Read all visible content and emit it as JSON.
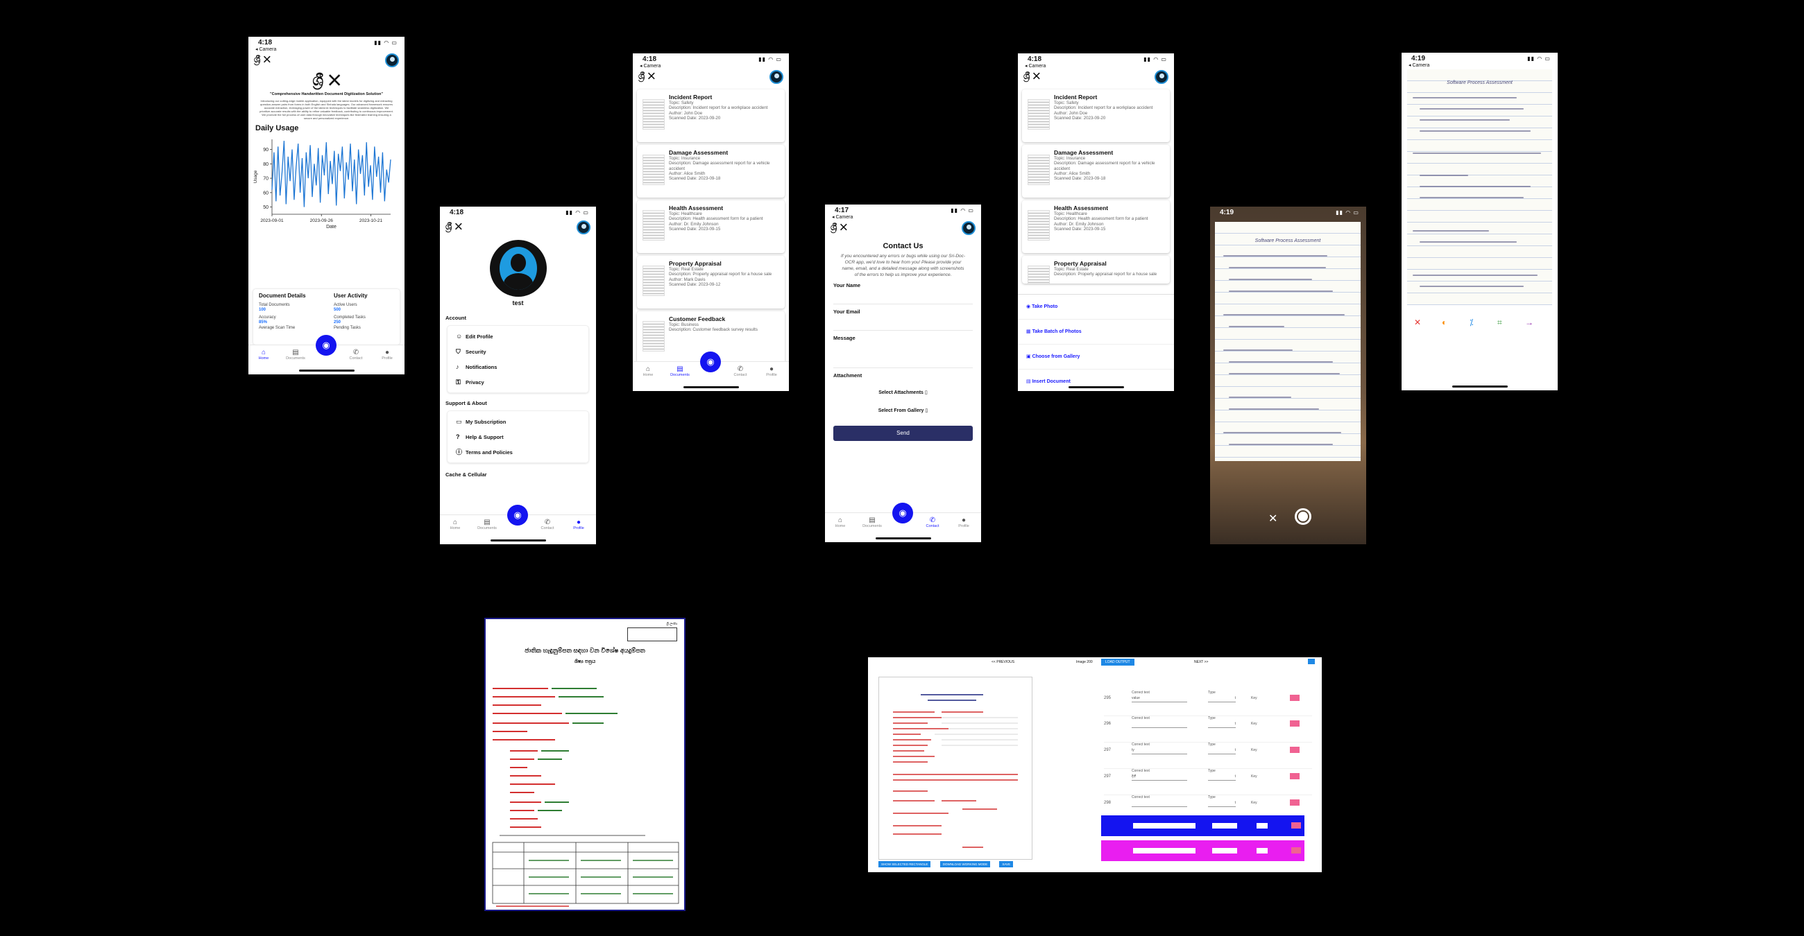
{
  "status": {
    "time_a": "4:18",
    "time_b": "4:17",
    "time_c": "4:19",
    "back": "◂ Camera",
    "icons": "▮▮ ◠ ▭"
  },
  "brand": {
    "logo": "ශ්‍රී ✕",
    "tagline": "\"Comprehensive Handwritten Document Digitization Solution\"",
    "intro": "Introducing our cutting-edge mobile application, equipped with the latest models for digitizing and extracting question-answer pairs from forms in both English and Sinhala languages. Our advanced framework ensures accurate extraction, leveraging power of the latest AI techniques to facilitate seamless digitization. We prioritize accurate results with the ability to refine valuable feedback, contributing to continuous improvement. We promote the full process of user data through innovative techniques like federated learning ensuring a secure and personalized experience."
  },
  "home": {
    "daily_title": "Daily Usage",
    "ylabel": "Usage",
    "xlabel": "Date",
    "details_title": "Document Details",
    "total_label": "Total Documents",
    "total_value": "100",
    "accuracy_label": "Accuracy",
    "accuracy_value": "85%",
    "avg_label": "Average Scan Time",
    "activity_title": "User Activity",
    "active_label": "Active Users",
    "active_value": "500",
    "completed_label": "Completed Tasks",
    "completed_value": "250",
    "pending_label": "Pending Tasks"
  },
  "chart_data": {
    "type": "line",
    "title": "Daily Usage",
    "xlabel": "Date",
    "ylabel": "Usage",
    "ylim": [
      45,
      97
    ],
    "yticks": [
      50,
      60,
      70,
      80,
      90
    ],
    "xticks": [
      "2023-09-01",
      "2023-09-26",
      "2023-10-21"
    ],
    "x_range": [
      "2023-09-01",
      "2023-10-31"
    ],
    "values": [
      62,
      88,
      54,
      92,
      58,
      74,
      96,
      52,
      85,
      68,
      90,
      55,
      78,
      94,
      60,
      84,
      50,
      88,
      70,
      93,
      57,
      80,
      65,
      91,
      53,
      86,
      72,
      95,
      59,
      82,
      66,
      89,
      51,
      87,
      75,
      92,
      56,
      81,
      69,
      94,
      61,
      83,
      52,
      90,
      73,
      86,
      58,
      95,
      64,
      79,
      55,
      92,
      71,
      85,
      60,
      88,
      54,
      76,
      67,
      83
    ],
    "grid": false
  },
  "tabs": [
    "Home",
    "Documents",
    "Contact",
    "Profile"
  ],
  "profile": {
    "name": "test",
    "account_title": "Account",
    "account_items": [
      "Edit Profile",
      "Security",
      "Notifications",
      "Privacy"
    ],
    "support_title": "Support & About",
    "support_items": [
      "My Subscription",
      "Help & Support",
      "Terms and Policies"
    ],
    "cache_title": "Cache & Cellular"
  },
  "documents": [
    {
      "title": "Incident Report",
      "topic": "Topic: Safety",
      "desc": "Description: Incident report for a workplace accident",
      "author": "Author: John Doe",
      "date": "Scanned Date: 2023-09-20"
    },
    {
      "title": "Damage Assessment",
      "topic": "Topic: Insurance",
      "desc": "Description: Damage assessment report for a vehicle accident",
      "author": "Author: Alice Smith",
      "date": "Scanned Date: 2023-09-18"
    },
    {
      "title": "Health Assessment",
      "topic": "Topic: Healthcare",
      "desc": "Description: Health assessment form for a patient",
      "author": "Author: Dr. Emily Johnson",
      "date": "Scanned Date: 2023-09-15"
    },
    {
      "title": "Property Appraisal",
      "topic": "Topic: Real Estate",
      "desc": "Description: Property appraisal report for a house sale",
      "author": "Author: Mark Davis",
      "date": "Scanned Date: 2023-09-12"
    },
    {
      "title": "Customer Feedback",
      "topic": "Topic: Business",
      "desc": "Description: Customer feedback survey results",
      "author": "",
      "date": ""
    }
  ],
  "contact": {
    "title": "Contact Us",
    "intro": "If you encountered any errors or bugs while using our Sri-Doc-OCR app, we'd love to hear from you! Please provide your name, email, and a detailed message along with screenshots of the errors to help us improve your experience.",
    "name_label": "Your Name",
    "email_label": "Your Email",
    "message_label": "Message",
    "attachment_label": "Attachment",
    "select_attachments": "Select Attachments",
    "select_gallery": "Select From Gallery",
    "send": "Send"
  },
  "sheet": {
    "options": [
      "Take Photo",
      "Take Batch of Photos",
      "Choose from Gallery",
      "Insert Document"
    ]
  },
  "scan_doc_title": "Software Process Assessment",
  "form": {
    "tag": "ශ්‍රී ලංකා",
    "heading": "ජාතික හැඳුනුම්පත සඳහා වන විශේෂ අයදුම්පත",
    "sub": "ශිෂ්‍ය පත්‍රය"
  },
  "editor": {
    "top": [
      "<< PREVIOUS",
      "Image 200",
      "LOAD OUTPUT",
      "NEXT >>"
    ],
    "rows": [
      {
        "num": "295",
        "value": "value"
      },
      {
        "num": "296",
        "value": ""
      },
      {
        "num": "297",
        "value": "ty"
      },
      {
        "num": "297",
        "value": "දිනී"
      },
      {
        "num": "298",
        "value": ""
      }
    ],
    "correct_label": "Correct text",
    "type_label": "Type",
    "type_value": "t",
    "key_value": "Key",
    "bottom_buttons": [
      "SHOW SELECTED RECTANGLE",
      "DOWNLOAD WORKING MODE",
      "SAVE"
    ]
  }
}
